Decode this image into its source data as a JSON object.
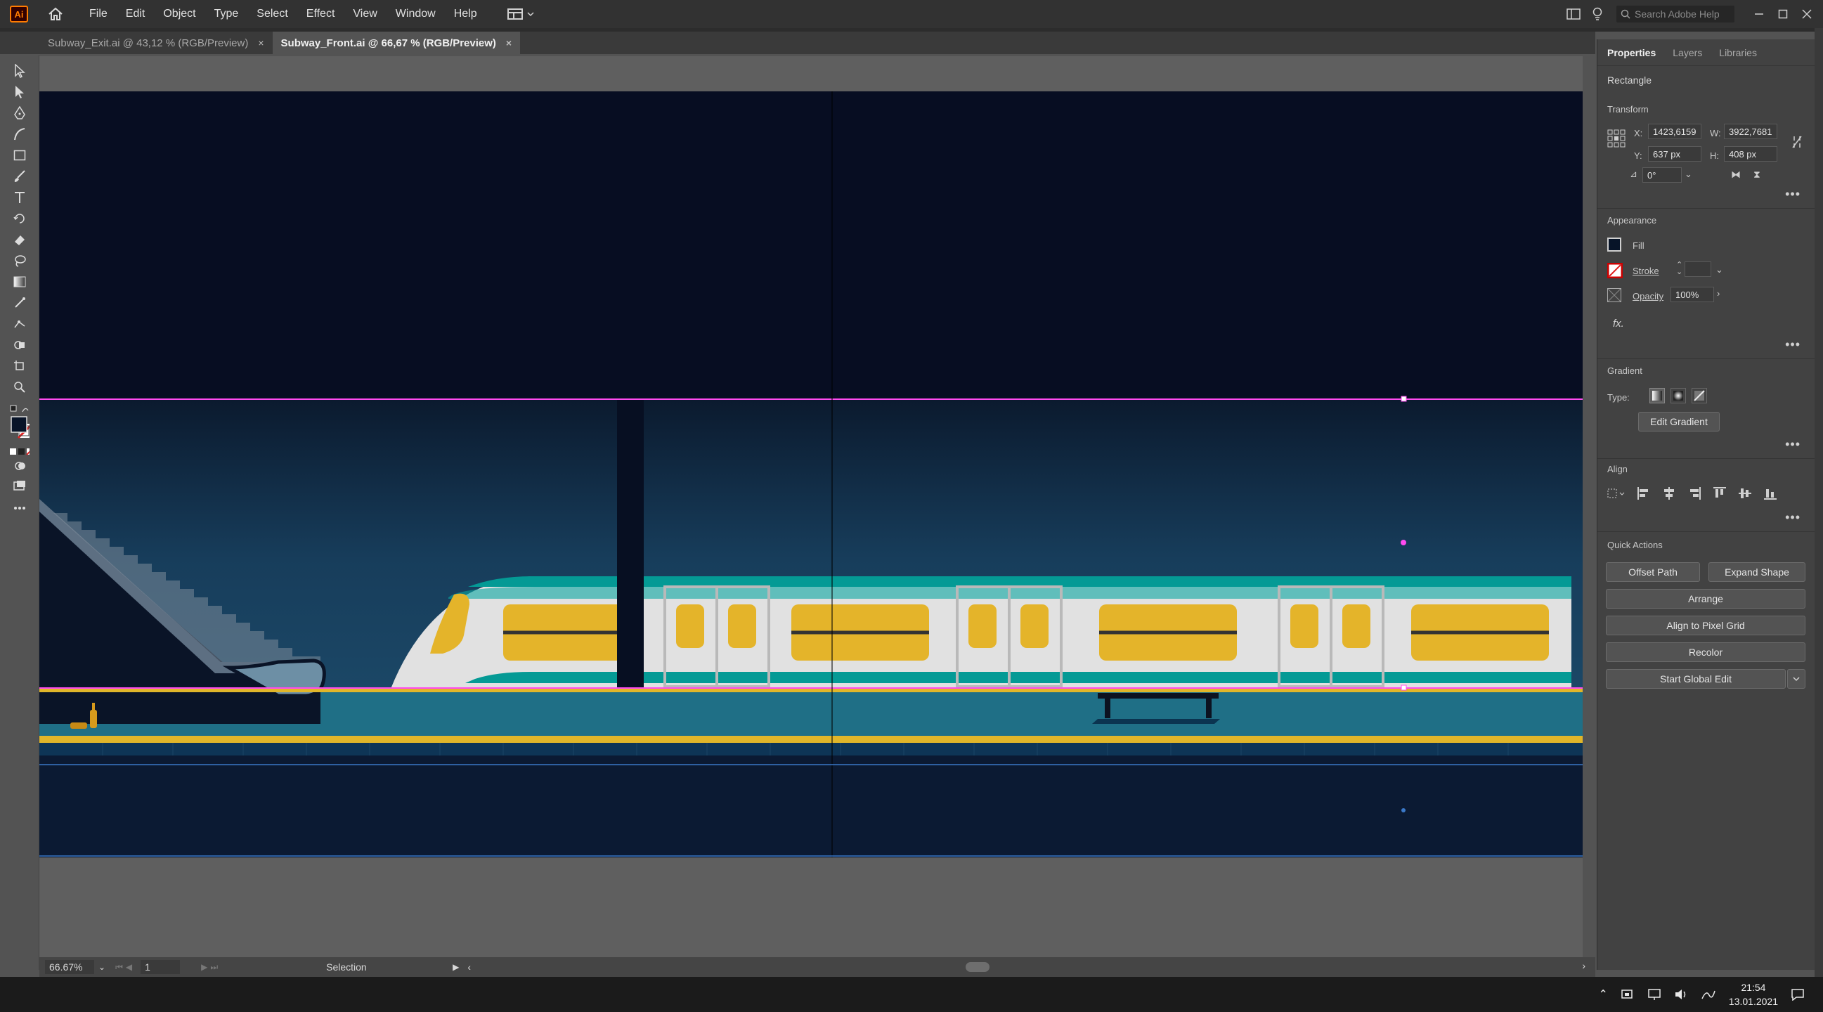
{
  "app": {
    "logo": "Ai",
    "menus": [
      "File",
      "Edit",
      "Object",
      "Type",
      "Select",
      "Effect",
      "View",
      "Window",
      "Help"
    ],
    "search_placeholder": "Search Adobe Help"
  },
  "tabs": [
    {
      "label": "Subway_Exit.ai @ 43,12 % (RGB/Preview)",
      "close": "×"
    },
    {
      "label": "Subway_Front.ai @ 66,67 % (RGB/Preview)",
      "close": "×"
    }
  ],
  "status": {
    "zoom": "66.67%",
    "artboard": "1",
    "mode": "Selection"
  },
  "panel": {
    "tabs": [
      "Properties",
      "Layers",
      "Libraries"
    ],
    "object_type": "Rectangle",
    "transform": {
      "title": "Transform",
      "x_label": "X:",
      "x_value": "1423,6159",
      "y_label": "Y:",
      "y_value": "637 px",
      "w_label": "W:",
      "w_value": "3922,7681",
      "h_label": "H:",
      "h_value": "408 px",
      "angle_value": "0°"
    },
    "appearance": {
      "title": "Appearance",
      "fill_label": "Fill",
      "stroke_label": "Stroke",
      "opacity_label": "Opacity",
      "opacity_value": "100%",
      "fx_label": "fx."
    },
    "gradient": {
      "title": "Gradient",
      "type_label": "Type:",
      "edit_button": "Edit Gradient"
    },
    "align": {
      "title": "Align"
    },
    "quick_actions": {
      "title": "Quick Actions",
      "offset_path": "Offset Path",
      "expand_shape": "Expand Shape",
      "arrange": "Arrange",
      "align_pixel": "Align to Pixel Grid",
      "recolor": "Recolor",
      "global_edit": "Start Global Edit"
    }
  },
  "taskbar": {
    "time": "21:54",
    "date": "13.01.2021"
  },
  "colors": {
    "sky_dark": "#070d22",
    "tunnel_top": "#0d1e33",
    "tunnel_mid": "#173a58",
    "platform": "#1f6f86",
    "platform_edge": "#e0b62a",
    "train_body": "#e1e1e1",
    "train_roof": "#049a95",
    "train_window": "#e4b42a",
    "selection_magenta": "#ff4bf0"
  }
}
